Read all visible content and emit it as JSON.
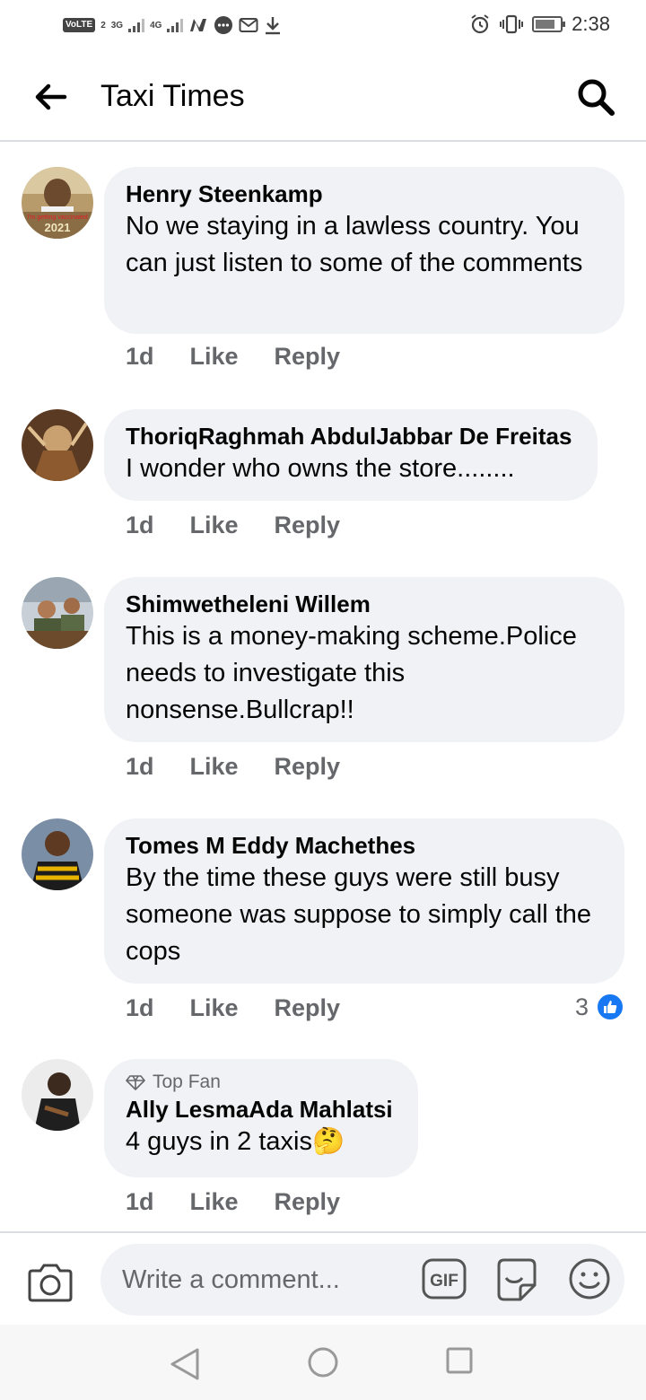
{
  "status_bar": {
    "left_icons": [
      "volte-icon",
      "signal-3g-icon",
      "signal-4g-icon",
      "n-icon",
      "messenger-icon",
      "gmail-icon",
      "download-icon"
    ],
    "volte_label": "VoLTE",
    "volte_sim": "2",
    "net1": "3G",
    "net2": "4G",
    "time": "2:38"
  },
  "header": {
    "title": "Taxi Times"
  },
  "comments": [
    {
      "author": "Henry Steenkamp",
      "text": "No we staying in a lawless country. You can just listen to some of the comments",
      "time": "1d",
      "like_label": "Like",
      "reply_label": "Reply",
      "avatar_caption": "I'm getting vaccinated",
      "avatar_year": "2021"
    },
    {
      "author": "ThoriqRaghmah AbdulJabbar De Freitas",
      "text": "I wonder who owns the store........",
      "time": "1d",
      "like_label": "Like",
      "reply_label": "Reply"
    },
    {
      "author": "Shimwetheleni Willem",
      "text": "This is a money-making scheme.Police needs to investigate this nonsense.Bullcrap!!",
      "time": "1d",
      "like_label": "Like",
      "reply_label": "Reply"
    },
    {
      "author": "Tomes M Eddy Machethes",
      "text": "By the time these guys were still busy someone was suppose to simply call the cops",
      "time": "1d",
      "like_label": "Like",
      "reply_label": "Reply",
      "reaction_count": "3"
    },
    {
      "badge": "Top Fan",
      "author": "Ally LesmaAda Mahlatsi",
      "text": "4 guys in 2 taxis🤔",
      "time": "1d",
      "like_label": "Like",
      "reply_label": "Reply"
    }
  ],
  "composer": {
    "placeholder": "Write a comment...",
    "gif_label": "GIF"
  },
  "colors": {
    "bubble": "#f0f2f5",
    "secondary_text": "#65676b",
    "like_blue": "#1877f2",
    "divider": "#dadde1"
  }
}
